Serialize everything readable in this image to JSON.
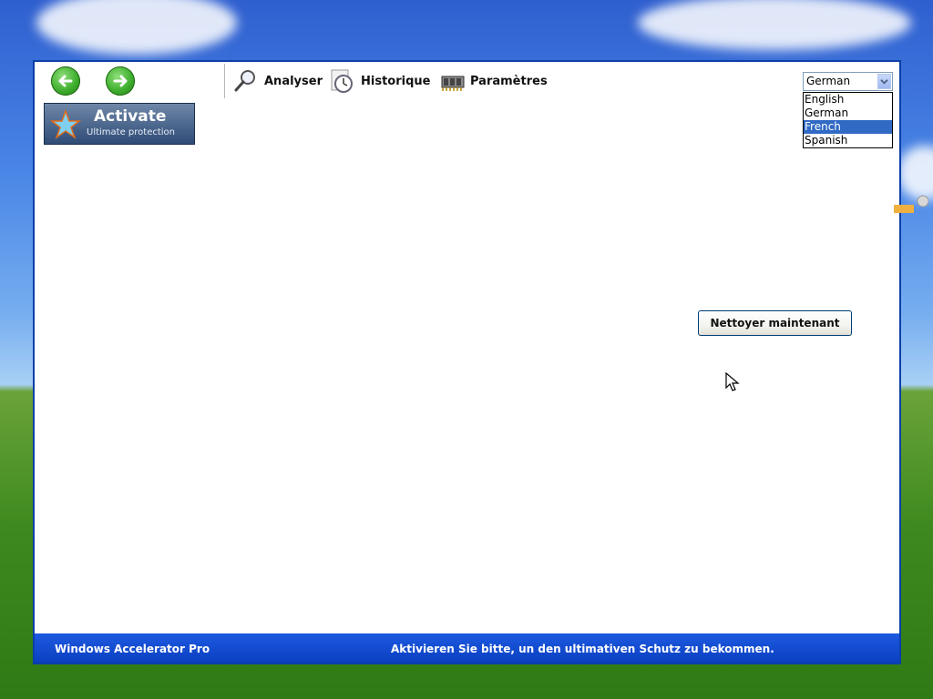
{
  "toolbar": {
    "tools": [
      {
        "label": "Analyser",
        "icon": "magnifier-icon"
      },
      {
        "label": "Historique",
        "icon": "clock-icon"
      },
      {
        "label": "Paramètres",
        "icon": "chip-icon"
      }
    ]
  },
  "activate": {
    "title": "Activate",
    "subtitle": "Ultimate protection"
  },
  "language": {
    "selected": "German",
    "options": [
      "English",
      "German",
      "French",
      "Spanish"
    ],
    "highlighted": "French"
  },
  "main": {
    "clean_button": "Nettoyer maintenant"
  },
  "statusbar": {
    "app_name": "Windows Accelerator Pro",
    "message": "Aktivieren Sie bitte, un den ultimativen Schutz zu bekommen."
  },
  "colors": {
    "statusbar_blue": "#0b3fc1",
    "highlight_blue": "#316ac5",
    "nav_green": "#3fae2e"
  }
}
